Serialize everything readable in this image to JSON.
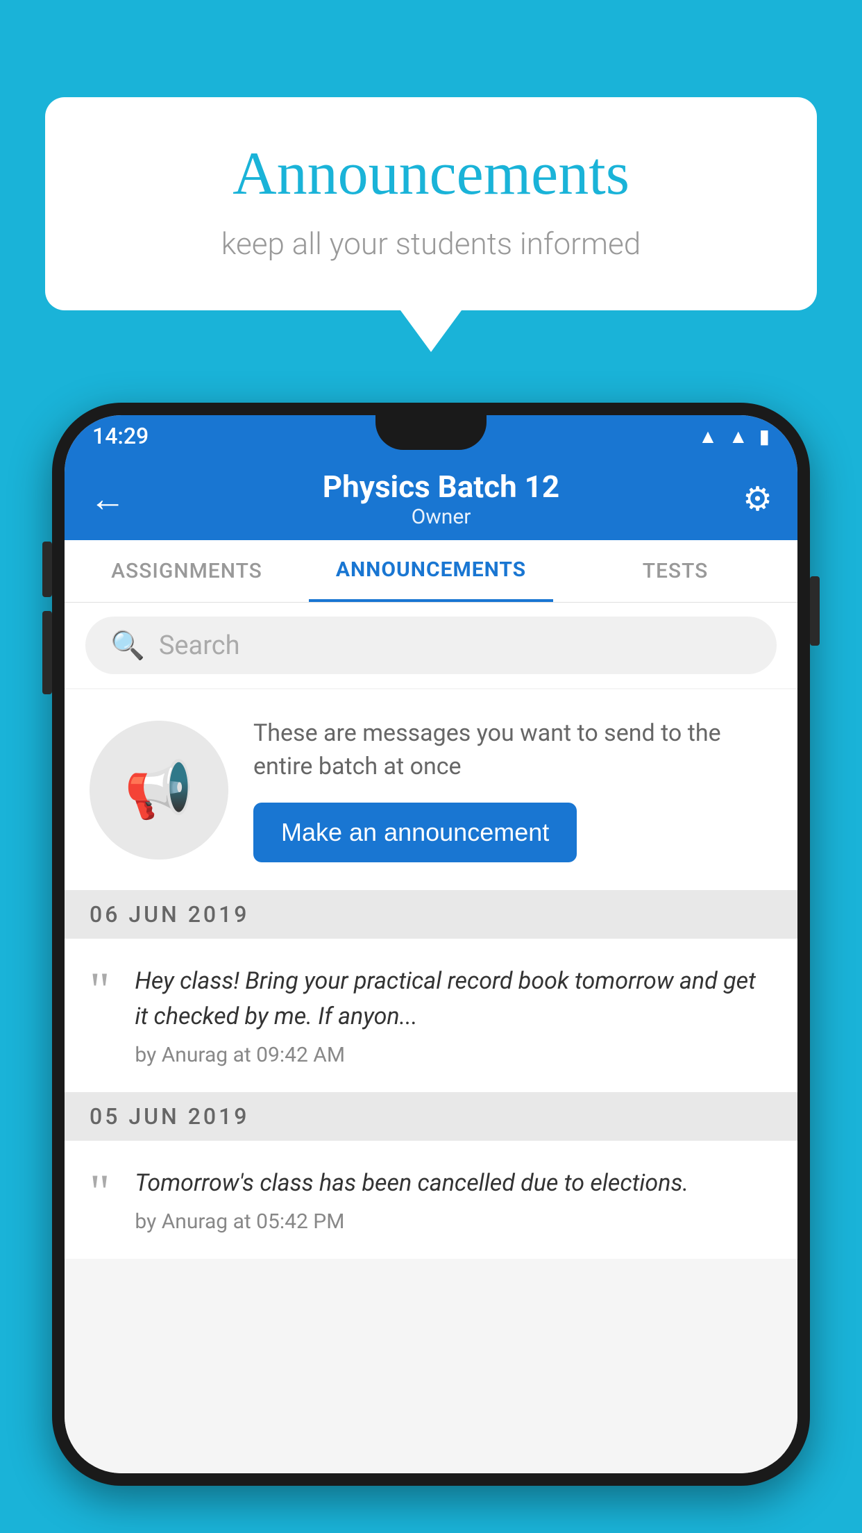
{
  "background_color": "#1ab3d8",
  "speech_bubble": {
    "title": "Announcements",
    "subtitle": "keep all your students informed"
  },
  "phone": {
    "status_bar": {
      "time": "14:29",
      "icons": [
        "wifi",
        "signal",
        "battery"
      ]
    },
    "app_bar": {
      "back_label": "←",
      "title": "Physics Batch 12",
      "subtitle": "Owner",
      "settings_label": "⚙"
    },
    "tabs": [
      {
        "label": "ASSIGNMENTS",
        "active": false
      },
      {
        "label": "ANNOUNCEMENTS",
        "active": true
      },
      {
        "label": "TESTS",
        "active": false
      }
    ],
    "search": {
      "placeholder": "Search"
    },
    "promo_card": {
      "description": "These are messages you want to send to the entire batch at once",
      "button_label": "Make an announcement"
    },
    "announcements": [
      {
        "date": "06  JUN  2019",
        "text": "Hey class! Bring your practical record book tomorrow and get it checked by me. If anyon...",
        "author": "by Anurag at 09:42 AM"
      },
      {
        "date": "05  JUN  2019",
        "text": "Tomorrow's class has been cancelled due to elections.",
        "author": "by Anurag at 05:42 PM"
      }
    ]
  }
}
